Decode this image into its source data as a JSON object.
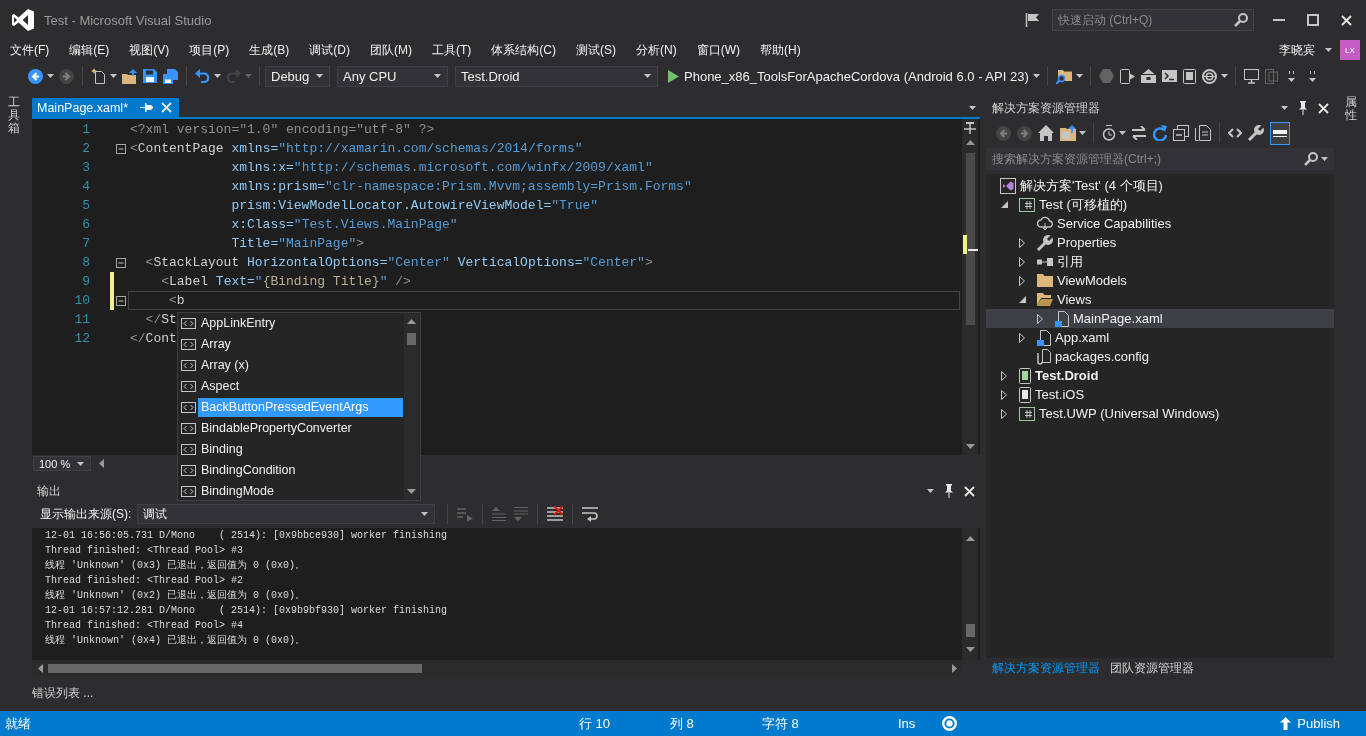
{
  "window": {
    "title": "Test - Microsoft Visual Studio",
    "quick_launch": {
      "placeholder": "快速启动 (Ctrl+Q)"
    }
  },
  "menu": [
    "文件(F)",
    "编辑(E)",
    "视图(V)",
    "项目(P)",
    "生成(B)",
    "调试(D)",
    "团队(M)",
    "工具(T)",
    "体系结构(C)",
    "测试(S)",
    "分析(N)",
    "窗口(W)",
    "帮助(H)"
  ],
  "account": {
    "name": "李晓宾",
    "initials": "LX"
  },
  "toolbar": {
    "buttons": [
      {
        "disabled": false
      },
      {
        "disabled": true
      },
      {
        "disabled": false
      },
      {
        "disabled": false
      },
      {
        "disabled": false
      },
      {
        "disabled": false
      },
      {
        "disabled": false
      },
      {
        "disabled": true
      }
    ],
    "configuration": "Debug",
    "platform": "Any CPU",
    "startup_project": "Test.Droid",
    "run_target": "Phone_x86_ToolsForApacheCordova (Android 6.0 - API 23)",
    "tools": [
      {
        "disabled": false
      },
      {
        "disabled": true
      },
      {
        "disabled": false
      },
      {
        "disabled": false
      },
      {
        "disabled": false
      },
      {
        "disabled": false
      },
      {
        "disabled": false
      },
      {
        "disabled": false
      },
      {
        "disabled": true
      }
    ]
  },
  "side_tabs": {
    "left": "工具箱",
    "right": "属性"
  },
  "editor": {
    "tabs": [
      {
        "label": "MainPage.xaml*",
        "selected": true
      }
    ],
    "lines": [
      {
        "number": "1",
        "tokens": [
          {
            "kind": "punct",
            "text": "<?xml version=\"1.0\" encoding=\"utf-8\" ?>"
          }
        ],
        "modified": false,
        "current": false
      },
      {
        "number": "2",
        "tokens": [
          {
            "kind": "punct",
            "text": "<"
          },
          {
            "kind": "element",
            "text": "ContentPage"
          },
          {
            "kind": "attr",
            "text": " xmlns="
          },
          {
            "kind": "value",
            "text": "\"http://xamarin.com/schemas/2014/forms\""
          }
        ],
        "expanded": true,
        "modified": false,
        "current": false
      },
      {
        "number": "3",
        "tokens": [
          {
            "kind": "attr",
            "text": "             xmlns:x="
          },
          {
            "kind": "value",
            "text": "\"http://schemas.microsoft.com/winfx/2009/xaml\""
          }
        ],
        "modified": false,
        "current": false
      },
      {
        "number": "4",
        "tokens": [
          {
            "kind": "attr",
            "text": "             xmlns:prism="
          },
          {
            "kind": "value",
            "text": "\"clr-namespace:Prism.Mvvm;assembly=Prism.Forms\""
          }
        ],
        "modified": false,
        "current": false
      },
      {
        "number": "5",
        "tokens": [
          {
            "kind": "attr",
            "text": "             prism:ViewModelLocator.AutowireViewModel="
          },
          {
            "kind": "value",
            "text": "\"True\""
          }
        ],
        "modified": false,
        "current": false
      },
      {
        "number": "6",
        "tokens": [
          {
            "kind": "attr",
            "text": "             x:Class="
          },
          {
            "kind": "value",
            "text": "\"Test.Views.MainPage\""
          }
        ],
        "modified": false,
        "current": false
      },
      {
        "number": "7",
        "tokens": [
          {
            "kind": "attr",
            "text": "             Title="
          },
          {
            "kind": "value",
            "text": "\"MainPage\""
          },
          {
            "kind": "punct",
            "text": ">"
          }
        ],
        "modified": false,
        "current": false
      },
      {
        "number": "8",
        "tokens": [
          {
            "kind": "punct",
            "text": "  <"
          },
          {
            "kind": "element",
            "text": "StackLayout"
          },
          {
            "kind": "attr",
            "text": " HorizontalOptions="
          },
          {
            "kind": "value",
            "text": "\"Center\""
          },
          {
            "kind": "attr",
            "text": " VerticalOptions="
          },
          {
            "kind": "value",
            "text": "\"Center\""
          },
          {
            "kind": "punct",
            "text": ">"
          }
        ],
        "expanded": true,
        "modified": false,
        "current": false
      },
      {
        "number": "9",
        "tokens": [
          {
            "kind": "punct",
            "text": "    <"
          },
          {
            "kind": "element",
            "text": "Label"
          },
          {
            "kind": "attr",
            "text": " Text="
          },
          {
            "kind": "value",
            "text": "\""
          },
          {
            "kind": "markup",
            "text": "{Binding Title}"
          },
          {
            "kind": "value",
            "text": "\""
          },
          {
            "kind": "punct",
            "text": " />"
          }
        ],
        "modified": true,
        "current": false
      },
      {
        "number": "10",
        "tokens": [
          {
            "kind": "punct",
            "text": "     <"
          },
          {
            "kind": "element",
            "text": "b"
          }
        ],
        "expanded": true,
        "modified": true,
        "current": true
      },
      {
        "number": "11",
        "tokens": [
          {
            "kind": "punct",
            "text": "  </"
          },
          {
            "kind": "element",
            "text": "St"
          }
        ],
        "modified": false,
        "current": false
      },
      {
        "number": "12",
        "tokens": [
          {
            "kind": "punct",
            "text": "</"
          },
          {
            "kind": "element",
            "text": "Cont"
          }
        ],
        "modified": false,
        "current": false
      }
    ],
    "completion": [
      {
        "label": "AppLinkEntry",
        "selected": false
      },
      {
        "label": "Array",
        "selected": false
      },
      {
        "label": "Array (x)",
        "selected": false
      },
      {
        "label": "Aspect",
        "selected": false
      },
      {
        "label": "BackButtonPressedEventArgs",
        "selected": true
      },
      {
        "label": "BindablePropertyConverter",
        "selected": false
      },
      {
        "label": "Binding",
        "selected": false
      },
      {
        "label": "BindingCondition",
        "selected": false
      },
      {
        "label": "BindingMode",
        "selected": false
      }
    ],
    "zoom": "100 %"
  },
  "output": {
    "title": "输出",
    "source_label": "显示输出来源(S):",
    "source": "调试",
    "tools": [
      {
        "disabled": true
      },
      {
        "disabled": true
      },
      {
        "disabled": true
      },
      {
        "disabled": false
      },
      {
        "disabled": false
      }
    ],
    "lines": [
      "12-01 16:56:05.731 D/Mono    ( 2514): [0x9bbce930] worker finishing",
      "Thread finished: <Thread Pool> #3",
      "线程 'Unknown' (0x3) 已退出，返回值为 0 (0x0)。",
      "Thread finished: <Thread Pool> #2",
      "线程 'Unknown' (0x2) 已退出，返回值为 0 (0x0)。",
      "12-01 16:57:12.281 D/Mono    ( 2514): [0x9b9bf930] worker finishing",
      "Thread finished: <Thread Pool> #4",
      "线程 'Unknown' (0x4) 已退出，返回值为 0 (0x0)。"
    ]
  },
  "error_list_tab": "错误列表 ...",
  "solution_explorer": {
    "title": "解决方案资源管理器",
    "toolbar": [
      {
        "disabled": true,
        "on": false
      },
      {
        "disabled": true,
        "on": false
      },
      {
        "disabled": false,
        "on": false
      },
      {
        "disabled": false,
        "on": false
      },
      {
        "disabled": false,
        "on": false
      },
      {
        "disabled": false,
        "on": false
      },
      {
        "disabled": false,
        "on": false
      },
      {
        "disabled": false,
        "on": false
      },
      {
        "disabled": false,
        "on": false
      },
      {
        "disabled": false,
        "on": false
      },
      {
        "disabled": false,
        "on": false
      },
      {
        "disabled": false,
        "on": true
      }
    ],
    "search": {
      "placeholder": "搜索解决方案资源管理器(Ctrl+;)"
    },
    "solution": {
      "label": "解决方案'Test' (4 个项目)",
      "selected": false,
      "children": [
        {
          "label": "Test (可移植的)",
          "kind": "project",
          "expanded": true,
          "selected": false,
          "startup": false,
          "children": [
            {
              "label": "Service Capabilities",
              "kind": "service",
              "selected": false
            },
            {
              "label": "Properties",
              "kind": "properties",
              "expanded": false,
              "selected": false
            },
            {
              "label": "引用",
              "kind": "references",
              "expanded": false,
              "selected": false
            },
            {
              "label": "ViewModels",
              "kind": "folder",
              "expanded": false,
              "selected": false
            },
            {
              "label": "Views",
              "kind": "folder",
              "expanded": true,
              "selected": false,
              "children": [
                {
                  "label": "MainPage.xaml",
                  "kind": "xaml",
                  "expanded": false,
                  "selected": true
                }
              ]
            },
            {
              "label": "App.xaml",
              "kind": "xaml",
              "expanded": false,
              "selected": false
            },
            {
              "label": "packages.config",
              "kind": "config",
              "selected": false
            }
          ]
        },
        {
          "label": "Test.Droid",
          "kind": "android",
          "expanded": false,
          "selected": false,
          "startup": true
        },
        {
          "label": "Test.iOS",
          "kind": "ios",
          "expanded": false,
          "selected": false,
          "startup": false
        },
        {
          "label": "Test.UWP (Universal Windows)",
          "kind": "project",
          "expanded": false,
          "selected": false,
          "startup": false
        }
      ]
    },
    "tabs": [
      {
        "label": "解决方案资源管理器",
        "selected": true
      },
      {
        "label": "团队资源管理器",
        "selected": false
      }
    ]
  },
  "status_bar": {
    "message": "就绪",
    "line": "行 10",
    "column": "列 8",
    "character": "字符 8",
    "mode": "Ins",
    "publish": "Publish"
  }
}
